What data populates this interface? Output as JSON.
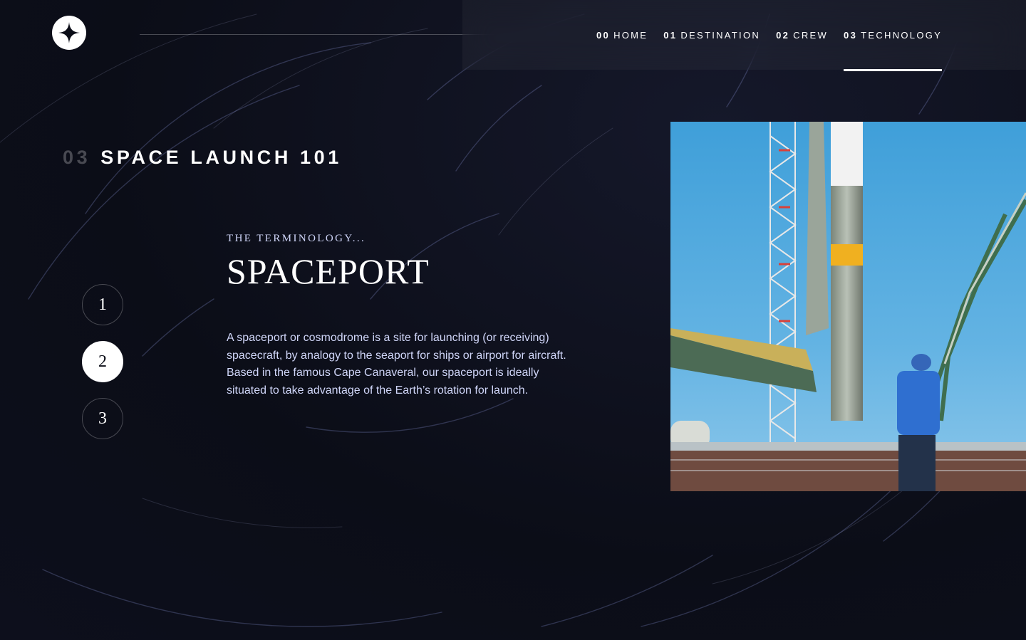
{
  "header": {
    "logo_icon": "star-icon",
    "nav": [
      {
        "num": "00",
        "label": "HOME",
        "active": false
      },
      {
        "num": "01",
        "label": "DESTINATION",
        "active": false
      },
      {
        "num": "02",
        "label": "CREW",
        "active": false
      },
      {
        "num": "03",
        "label": "TECHNOLOGY",
        "active": true
      }
    ]
  },
  "page": {
    "number": "03",
    "title": "SPACE LAUNCH 101"
  },
  "stepper": {
    "steps": [
      "1",
      "2",
      "3"
    ],
    "active": "2"
  },
  "content": {
    "eyebrow": "THE TERMINOLOGY...",
    "name": "SPACEPORT",
    "description": "A spaceport or cosmodrome is a site for launching (or receiving) spacecraft, by analogy to the seaport for ships or airport for aircraft. Based in the famous Cape Canaveral, our spaceport is ideally situated to take advantage of the Earth’s rotation for launch."
  },
  "image": {
    "subject": "rocket-on-launch-pad-photo"
  },
  "colors": {
    "background": "#0b0d17",
    "text": "#ffffff",
    "muted_text": "#d0d6f9"
  }
}
